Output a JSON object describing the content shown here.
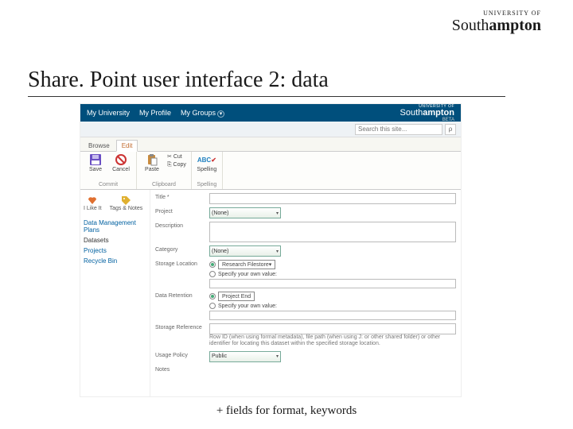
{
  "page_logo": {
    "pre": "UNIVERSITY OF",
    "name_light": "South",
    "name_bold": "ampton"
  },
  "slide_title": "Share. Point user interface 2: data",
  "topnav": {
    "my_university": "My University",
    "my_profile": "My Profile",
    "my_groups": "My Groups",
    "beta": "BETA"
  },
  "search": {
    "placeholder": "Search this site..."
  },
  "ribbon": {
    "tab_browse": "Browse",
    "tab_edit": "Edit",
    "save": "Save",
    "cancel": "Cancel",
    "paste": "Paste",
    "cut": "Cut",
    "copy": "Copy",
    "spelling": "Spelling",
    "grp_commit": "Commit",
    "grp_clipboard": "Clipboard",
    "grp_spelling": "Spelling"
  },
  "sidebar": {
    "like": "I Like It",
    "tags": "Tags & Notes",
    "dmp": "Data Management Plans",
    "datasets": "Datasets",
    "projects": "Projects",
    "recycle": "Recycle Bin"
  },
  "form": {
    "title_label": "Title *",
    "project_label": "Project",
    "project_value": "(None)",
    "desc_label": "Description",
    "category_label": "Category",
    "category_value": "(None)",
    "storage_loc_label": "Storage Location",
    "storage_loc_value": "Research Filestore",
    "specify_own": "Specify your own value:",
    "data_retention_label": "Data Retention",
    "retention_value": "Project End",
    "storage_ref_label": "Storage Reference",
    "storage_ref_help": "Row ID (when using formal metadata), file path (when using J: or other shared folder) or other identifier for locating this dataset within the specified storage location.",
    "usage_policy_label": "Usage Policy",
    "usage_policy_value": "Public",
    "notes_label": "Notes"
  },
  "footer_note": "+ fields for format, keywords"
}
